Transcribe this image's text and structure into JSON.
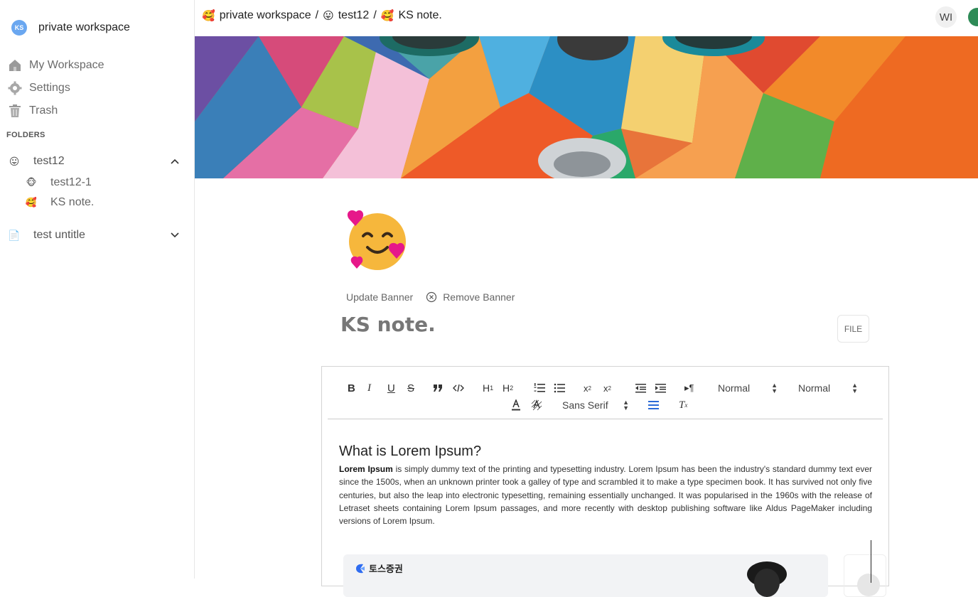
{
  "sidebar": {
    "workspace_logo": "KS",
    "workspace_name": "private workspace",
    "nav": [
      {
        "label": "My Workspace",
        "icon": "home-icon"
      },
      {
        "label": "Settings",
        "icon": "gear-icon"
      },
      {
        "label": "Trash",
        "icon": "trash-icon"
      }
    ],
    "folders_title": "FOLDERS",
    "folders": [
      {
        "emoji": "😛",
        "label": "test12",
        "expanded": true,
        "files": [
          {
            "emoji": "🐵",
            "label": "test12-1"
          },
          {
            "emoji": "🥰",
            "label": "KS note."
          }
        ]
      },
      {
        "emoji": "📄",
        "label": "test untitle",
        "expanded": false,
        "files": []
      }
    ]
  },
  "header": {
    "breadcrumb": [
      {
        "emoji": "🥰",
        "label": "private workspace"
      },
      {
        "emoji": "😛",
        "label": "test12"
      },
      {
        "emoji": "🥰",
        "label": "KS note."
      }
    ],
    "separator": "/",
    "avatar_initials": "WI",
    "avatar2_color": "#2e8b57"
  },
  "document": {
    "update_banner": "Update Banner",
    "remove_banner": "Remove Banner",
    "title": "KS note.",
    "file_button": "FILE"
  },
  "toolbar": {
    "header_picker": "Normal",
    "size_picker": "Normal",
    "font_picker": "Sans Serif"
  },
  "content": {
    "heading": "What is Lorem Ipsum?",
    "lead_bold": "Lorem Ipsum",
    "body": " is simply dummy text of the printing and typesetting industry. Lorem Ipsum has been the industry's standard dummy text ever since the 1500s, when an unknown printer took a galley of type and scrambled it to make a type specimen book. It has survived not only five centuries, but also the leap into electronic typesetting, remaining essentially unchanged. It was popularised in the 1960s with the release of Letraset sheets containing Lorem Ipsum passages, and more recently with desktop publishing software like Aldus PageMaker including versions of Lorem Ipsum.",
    "card_brand": "토스증권"
  }
}
